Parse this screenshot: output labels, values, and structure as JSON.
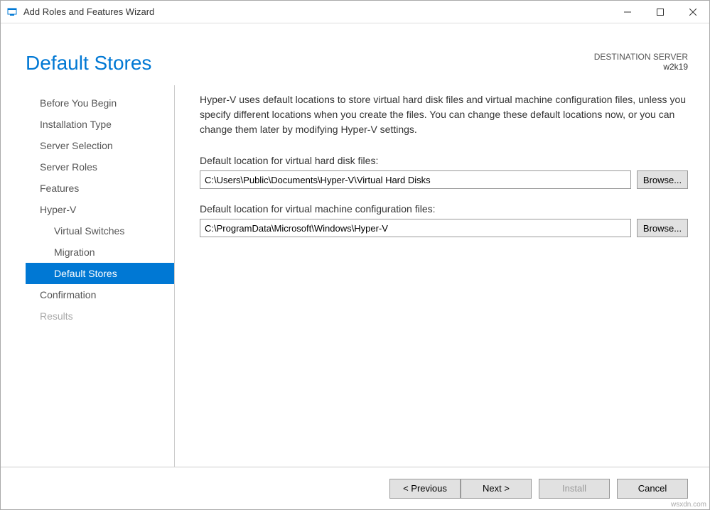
{
  "titlebar": {
    "title": "Add Roles and Features Wizard"
  },
  "header": {
    "page_title": "Default Stores",
    "destination_label": "DESTINATION SERVER",
    "destination_server": "w2k19"
  },
  "sidebar": {
    "items": [
      {
        "label": "Before You Begin",
        "indent": 0,
        "selected": false,
        "disabled": false
      },
      {
        "label": "Installation Type",
        "indent": 0,
        "selected": false,
        "disabled": false
      },
      {
        "label": "Server Selection",
        "indent": 0,
        "selected": false,
        "disabled": false
      },
      {
        "label": "Server Roles",
        "indent": 0,
        "selected": false,
        "disabled": false
      },
      {
        "label": "Features",
        "indent": 0,
        "selected": false,
        "disabled": false
      },
      {
        "label": "Hyper-V",
        "indent": 0,
        "selected": false,
        "disabled": false
      },
      {
        "label": "Virtual Switches",
        "indent": 1,
        "selected": false,
        "disabled": false
      },
      {
        "label": "Migration",
        "indent": 1,
        "selected": false,
        "disabled": false
      },
      {
        "label": "Default Stores",
        "indent": 1,
        "selected": true,
        "disabled": false
      },
      {
        "label": "Confirmation",
        "indent": 0,
        "selected": false,
        "disabled": false
      },
      {
        "label": "Results",
        "indent": 0,
        "selected": false,
        "disabled": true
      }
    ]
  },
  "main": {
    "description": "Hyper-V uses default locations to store virtual hard disk files and virtual machine configuration files, unless you specify different locations when you create the files. You can change these default locations now, or you can change them later by modifying Hyper-V settings.",
    "vhd_label": "Default location for virtual hard disk files:",
    "vhd_path": "C:\\Users\\Public\\Documents\\Hyper-V\\Virtual Hard Disks",
    "config_label": "Default location for virtual machine configuration files:",
    "config_path": "C:\\ProgramData\\Microsoft\\Windows\\Hyper-V",
    "browse_label": "Browse..."
  },
  "footer": {
    "previous": "< Previous",
    "next": "Next >",
    "install": "Install",
    "cancel": "Cancel"
  },
  "watermark": "wsxdn.com"
}
